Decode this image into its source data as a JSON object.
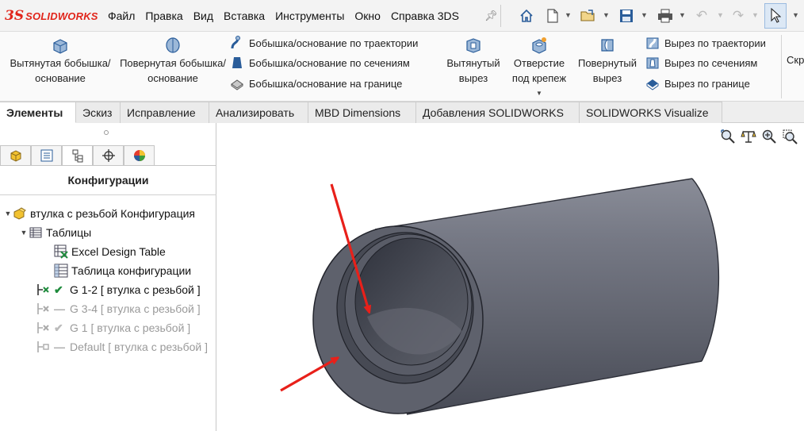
{
  "app": {
    "brand_mark": "3S",
    "brand_name": "SOLIDWORKS"
  },
  "menu": {
    "items": [
      "Файл",
      "Правка",
      "Вид",
      "Вставка",
      "Инструменты",
      "Окно",
      "Справка 3DS"
    ]
  },
  "quick_access": {
    "icons": [
      "home-icon",
      "new-document-icon",
      "open-folder-icon",
      "save-icon",
      "print-icon",
      "undo-icon",
      "redo-icon",
      "select-cursor-icon"
    ]
  },
  "ribbon": {
    "extruded_boss": "Вытянутая бобышка/основание",
    "revolved_boss": "Повернутая бобышка/основание",
    "swept_boss": "Бобышка/основание по траектории",
    "lofted_boss": "Бобышка/основание по сечениям",
    "boundary_boss": "Бобышка/основание на границе",
    "extruded_cut": "Вытянутый вырез",
    "hole_wizard": "Отверстие под крепеж",
    "revolved_cut": "Повернутый вырез",
    "swept_cut": "Вырез по траектории",
    "lofted_cut": "Вырез по сечениям",
    "boundary_cut": "Вырез по границе",
    "truncated": "Скр"
  },
  "tabs": [
    "Элементы",
    "Эскиз",
    "Исправление",
    "Анализировать",
    "MBD Dimensions",
    "Добавления SOLIDWORKS",
    "SOLIDWORKS Visualize"
  ],
  "active_tab": "Элементы",
  "panel": {
    "tab_icons": [
      "feature-manager-icon",
      "property-manager-icon",
      "configuration-manager-icon",
      "dimxpert-icon",
      "display-manager-icon"
    ],
    "title": "Конфигурации",
    "tree": {
      "root": "втулка с резьбой Конфигурация",
      "tables": "Таблицы",
      "excel_table": "Excel Design Table",
      "config_table": "Таблица конфигурации",
      "configs": [
        {
          "label": "G 1-2 [ втулка с резьбой ]",
          "state": "active"
        },
        {
          "label": "G 3-4 [ втулка с резьбой ]",
          "state": "dim"
        },
        {
          "label": "G 1 [ втулка с резьбой ]",
          "state": "dim"
        },
        {
          "label": "Default [ втулка с резьбой ]",
          "state": "dim"
        }
      ]
    }
  },
  "viewport": {
    "tool_icons": [
      "zoom-to-fit-icon",
      "zoom-to-area-icon",
      "previous-view-icon",
      "section-view-icon"
    ]
  },
  "colors": {
    "brand": "#e1251b",
    "annotation_arrow": "#e8201a",
    "part_body": "#6a6d78",
    "tab_active_bg": "#ffffff"
  }
}
